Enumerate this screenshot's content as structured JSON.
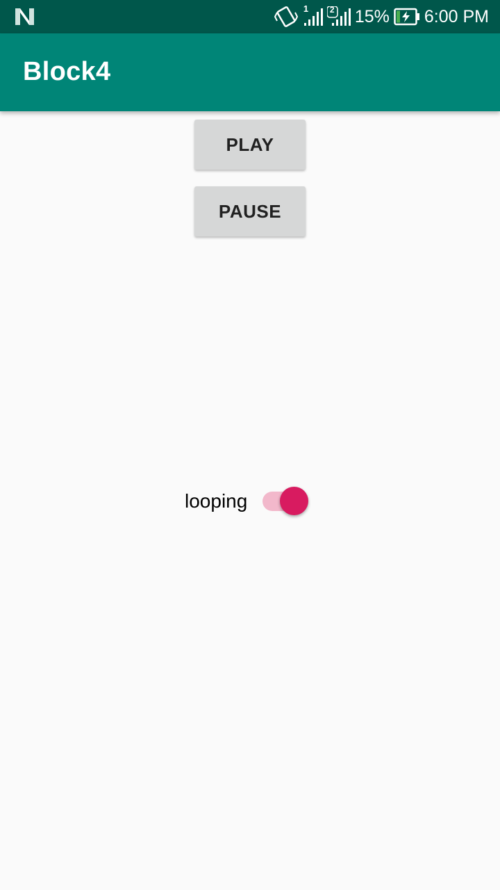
{
  "status_bar": {
    "battery_percent": "15%",
    "time": "6:00 PM",
    "sim1_label": "1",
    "sim2_label": "2",
    "icons": [
      "n-logo-icon",
      "vibrate-icon",
      "signal-icon",
      "signal-icon",
      "battery-charging-icon"
    ]
  },
  "app_bar": {
    "title": "Block4"
  },
  "buttons": {
    "play": "PLAY",
    "pause": "PAUSE"
  },
  "looping": {
    "label": "looping",
    "checked": true
  },
  "colors": {
    "status_bar": "#00574b",
    "app_bar": "#008577",
    "accent": "#d81b60",
    "button": "#d6d7d7",
    "background": "#fafafa"
  }
}
